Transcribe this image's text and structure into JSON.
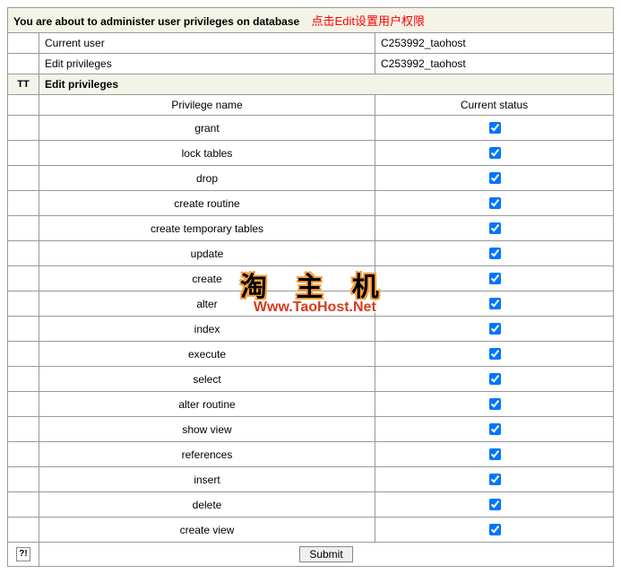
{
  "header": {
    "title": "You are about to administer user privileges on database",
    "annotation": "点击Edit设置用户权限"
  },
  "info": {
    "current_user_label": "Current user",
    "current_user_value": "C253992_taohost",
    "edit_priv_label": "Edit privileges",
    "edit_priv_value": "C253992_taohost"
  },
  "section": {
    "tt": "TT",
    "title": "Edit privileges",
    "col_name": "Privilege name",
    "col_status": "Current status"
  },
  "privileges": [
    {
      "name": "grant",
      "checked": true
    },
    {
      "name": "lock tables",
      "checked": true
    },
    {
      "name": "drop",
      "checked": true
    },
    {
      "name": "create routine",
      "checked": true
    },
    {
      "name": "create temporary tables",
      "checked": true
    },
    {
      "name": "update",
      "checked": true
    },
    {
      "name": "create",
      "checked": true
    },
    {
      "name": "alter",
      "checked": true
    },
    {
      "name": "index",
      "checked": true
    },
    {
      "name": "execute",
      "checked": true
    },
    {
      "name": "select",
      "checked": true
    },
    {
      "name": "alter routine",
      "checked": true
    },
    {
      "name": "show view",
      "checked": true
    },
    {
      "name": "references",
      "checked": true
    },
    {
      "name": "insert",
      "checked": true
    },
    {
      "name": "delete",
      "checked": true
    },
    {
      "name": "create view",
      "checked": true
    }
  ],
  "footer": {
    "help_icon": "?!",
    "submit_label": "Submit"
  },
  "watermark": {
    "cn": "淘 主 机",
    "en": "Www.TaoHost.Net"
  }
}
